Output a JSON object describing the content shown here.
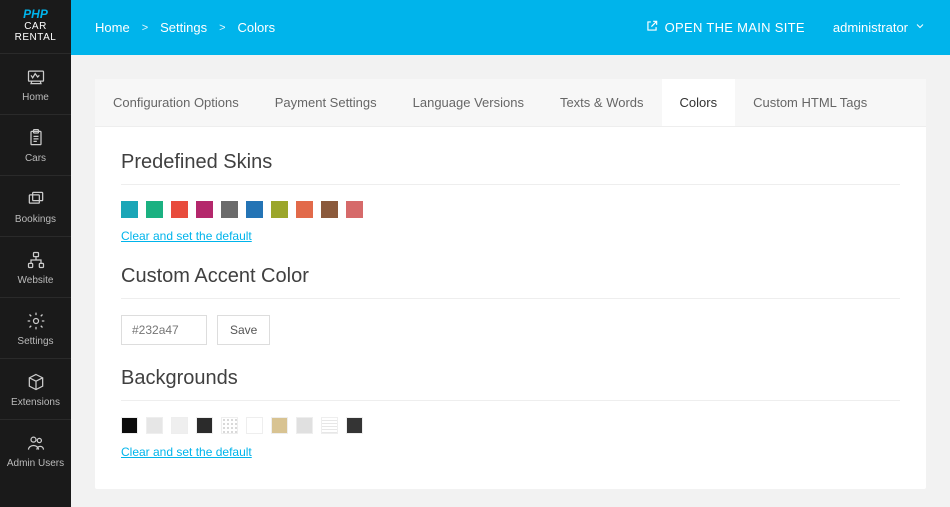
{
  "brand": {
    "line1": "PHP",
    "line2": "CAR",
    "line3": "RENTAL"
  },
  "sidebar": {
    "items": [
      {
        "label": "Home"
      },
      {
        "label": "Cars"
      },
      {
        "label": "Bookings"
      },
      {
        "label": "Website"
      },
      {
        "label": "Settings"
      },
      {
        "label": "Extensions"
      },
      {
        "label": "Admin Users"
      }
    ]
  },
  "breadcrumb": {
    "a": "Home",
    "b": "Settings",
    "c": "Colors",
    "sep": ">"
  },
  "topbar": {
    "open_site": "OPEN THE MAIN SITE",
    "user": "administrator"
  },
  "tabs": [
    {
      "label": "Configuration Options"
    },
    {
      "label": "Payment Settings"
    },
    {
      "label": "Language Versions"
    },
    {
      "label": "Texts & Words"
    },
    {
      "label": "Colors"
    },
    {
      "label": "Custom HTML Tags"
    }
  ],
  "sections": {
    "predefined": {
      "title": "Predefined Skins",
      "colors": [
        "#1aa6b7",
        "#1bb181",
        "#e84c3d",
        "#b4286c",
        "#6b6b6b",
        "#2474b5",
        "#9ba62b",
        "#e26a4a",
        "#8b5a3c",
        "#d66a6a"
      ],
      "clear": "Clear and set the default"
    },
    "custom": {
      "title": "Custom Accent Color",
      "placeholder": "#232a47",
      "value": "",
      "save": "Save"
    },
    "backgrounds": {
      "title": "Backgrounds",
      "swatches": [
        {
          "class": "",
          "style": "background:#0b0b0b"
        },
        {
          "class": "",
          "style": "background:#e6e6e6"
        },
        {
          "class": "",
          "style": "background:#efefef"
        },
        {
          "class": "",
          "style": "background:#2b2b2b"
        },
        {
          "class": "pattern-dots",
          "style": ""
        },
        {
          "class": "",
          "style": "background:#ffffff"
        },
        {
          "class": "",
          "style": "background:#d8c392"
        },
        {
          "class": "",
          "style": "background:#e0e0e0"
        },
        {
          "class": "pattern-lines",
          "style": ""
        },
        {
          "class": "",
          "style": "background:#343434"
        }
      ],
      "clear": "Clear and set the default"
    }
  }
}
